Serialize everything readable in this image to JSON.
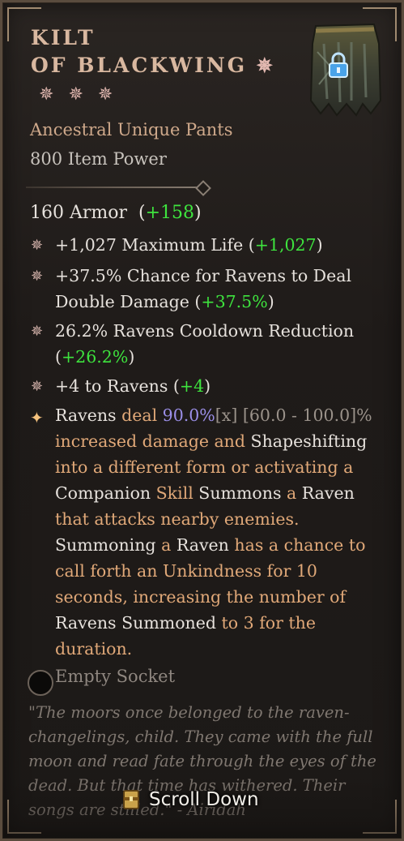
{
  "item": {
    "name_line1": "KILT",
    "name_line2": "OF BLACKWING",
    "type": "Ancestral Unique Pants",
    "item_power": "800 Item Power",
    "armor_label": "160 Armor",
    "armor_delta_open": "(",
    "armor_delta": "+158",
    "armor_delta_close": ")"
  },
  "affixes": [
    {
      "text": "+1,027 Maximum Life (",
      "delta": "+1,027",
      "close": ")"
    },
    {
      "text": "+37.5% Chance for Ravens to Deal Double Damage (",
      "delta": "+37.5%",
      "close": ")"
    },
    {
      "text": "26.2% Ravens Cooldown Reduction (",
      "delta": "+26.2%",
      "close": ")"
    },
    {
      "text": "+4 to Ravens (",
      "delta": "+4",
      "close": ")"
    }
  ],
  "unique_power": {
    "p1": "Ravens",
    "p2": " deal ",
    "p3": "90.0%",
    "p4": "[x]",
    "p5": " [60.0 - 100.0]%",
    "p6": " increased damage and ",
    "p7": "Shapeshifting",
    "p8": " into a different form or activating a ",
    "p9": "Companion",
    "p10": " Skill ",
    "p11": "Summons",
    "p12": " a ",
    "p13": "Raven",
    "p14": " that attacks nearby enemies. ",
    "p15": "Summoning",
    "p16": " a ",
    "p17": "Raven",
    "p18": " has a chance to call forth an Unkindness for 10 seconds, increasing the number of ",
    "p19": "Ravens Summoned",
    "p20": " to 3 for the duration."
  },
  "socket": {
    "label": "Empty Socket"
  },
  "flavor": "\"The moors once belonged to the raven-changelings, child. They came with the full moon and read fate through the eyes of the dead. But that time has withered. Their songs are stilled.\" - Airidah",
  "scroll": {
    "label": "Scroll Down"
  },
  "icons": {
    "affix_bullet": "snowflake-star-icon",
    "unique_bullet": "sparkle-star-icon",
    "lock": "padlock-icon",
    "socket": "gem-socket-icon",
    "scroll": "scroll-treasure-icon"
  },
  "colors": {
    "title": "#d9b8a0",
    "type": "#cfa98b",
    "delta_green": "#3ee43e",
    "keyword_orange": "#e0a878",
    "value_blue": "#9b8fe8"
  }
}
